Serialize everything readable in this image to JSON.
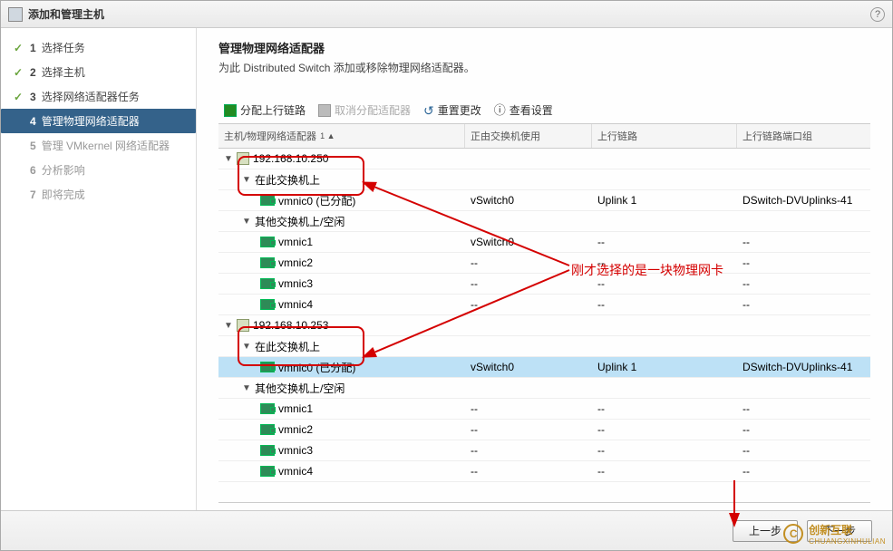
{
  "dialog": {
    "title": "添加和管理主机"
  },
  "steps": [
    {
      "num": "1",
      "label": "选择任务",
      "state": "done"
    },
    {
      "num": "2",
      "label": "选择主机",
      "state": "done"
    },
    {
      "num": "3",
      "label": "选择网络适配器任务",
      "state": "done"
    },
    {
      "num": "4",
      "label": "管理物理网络适配器",
      "state": "active"
    },
    {
      "num": "5",
      "label": "管理 VMkernel 网络适配器",
      "state": "inactive"
    },
    {
      "num": "6",
      "label": "分析影响",
      "state": "inactive"
    },
    {
      "num": "7",
      "label": "即将完成",
      "state": "inactive"
    }
  ],
  "main": {
    "title": "管理物理网络适配器",
    "subtitle": "为此 Distributed Switch 添加或移除物理网络适配器。"
  },
  "toolbar": {
    "assign": "分配上行链路",
    "unassign": "取消分配适配器",
    "reset": "重置更改",
    "view": "查看设置"
  },
  "columns": {
    "c1": "主机/物理网络适配器",
    "c1sort": "1 ▲",
    "c2": "正由交换机使用",
    "c3": "上行链路",
    "c4": "上行链路端口组"
  },
  "hosts": [
    {
      "ip": "192.168.10.250",
      "on_label": "在此交换机上",
      "idle_label": "其他交换机上/空闲",
      "assigned": [
        {
          "name": "vmnic0 (已分配)",
          "switch": "vSwitch0",
          "uplink": "Uplink 1",
          "pg": "DSwitch-DVUplinks-41",
          "highlight": true
        }
      ],
      "idle": [
        {
          "name": "vmnic1",
          "switch": "vSwitch0",
          "uplink": "--",
          "pg": "--"
        },
        {
          "name": "vmnic2",
          "switch": "--",
          "uplink": "--",
          "pg": "--"
        },
        {
          "name": "vmnic3",
          "switch": "--",
          "uplink": "--",
          "pg": "--"
        },
        {
          "name": "vmnic4",
          "switch": "--",
          "uplink": "--",
          "pg": "--"
        }
      ]
    },
    {
      "ip": "192.168.10.253",
      "on_label": "在此交换机上",
      "idle_label": "其他交换机上/空闲",
      "assigned": [
        {
          "name": "vmnic0 (已分配)",
          "switch": "vSwitch0",
          "uplink": "Uplink 1",
          "pg": "DSwitch-DVUplinks-41",
          "highlight": true,
          "selected": true
        }
      ],
      "idle": [
        {
          "name": "vmnic1",
          "switch": "--",
          "uplink": "--",
          "pg": "--"
        },
        {
          "name": "vmnic2",
          "switch": "--",
          "uplink": "--",
          "pg": "--"
        },
        {
          "name": "vmnic3",
          "switch": "--",
          "uplink": "--",
          "pg": "--"
        },
        {
          "name": "vmnic4",
          "switch": "--",
          "uplink": "--",
          "pg": "--"
        }
      ]
    }
  ],
  "footer": {
    "back": "上一步",
    "next": "下一步"
  },
  "annotation": {
    "text": "刚才选择的是一块物理网卡"
  },
  "watermark": {
    "brand": "创新互联",
    "sub": "CHUANGXINHULIAN"
  }
}
